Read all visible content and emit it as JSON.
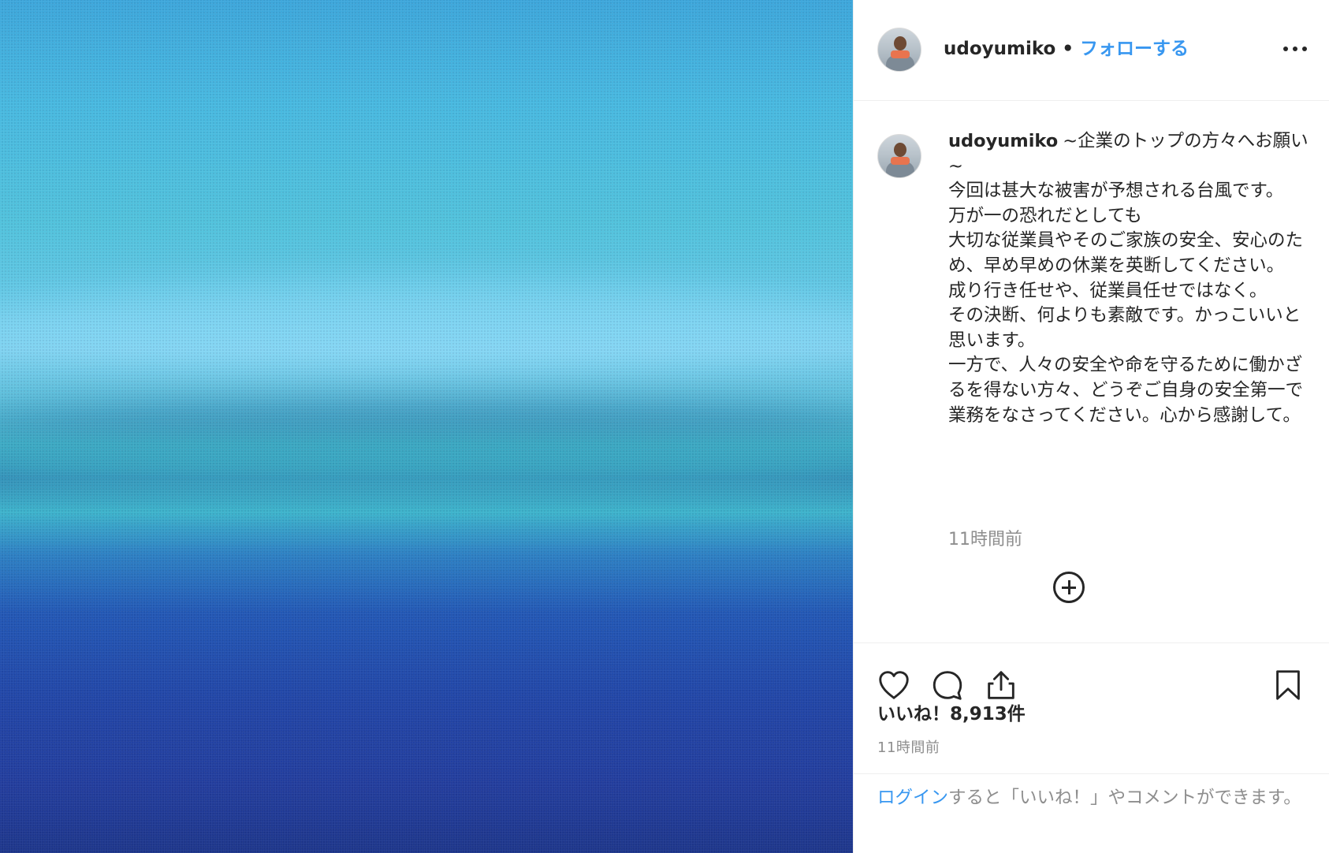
{
  "post": {
    "username": "udoyumiko",
    "dot": "•",
    "follow_label": "フォローする",
    "caption_lines": [
      "~企業のトップの方々へお願い~",
      "今回は甚大な被害が予想される台風です。",
      "万が一の恐れだとしても",
      "大切な従業員やそのご家族の安全、安心のため、早め早めの休業を英断してください。",
      "成り行き任せや、従業員任せではなく。",
      "その決断、何よりも素敵です。かっこいいと思います。",
      "一方で、人々の安全や命を守るために働かざるを得ない方々、どうぞご自身の安全第一で業務をなさってください。心から感謝して。"
    ],
    "comment_time": "11時間前",
    "likes": "いいね！8,913件",
    "post_time": "11時間前"
  },
  "login": {
    "link_label": "ログイン",
    "rest": "すると「いいね！」やコメントができます。"
  },
  "icons": {
    "more": "more-options-icon",
    "load_more": "plus-circle-icon",
    "like": "heart-icon",
    "comment": "comment-bubble-icon",
    "share": "share-icon",
    "save": "bookmark-icon"
  },
  "colors": {
    "link": "#3897f0",
    "muted": "#8e8e8e",
    "text": "#262626",
    "divider": "#efefef"
  }
}
